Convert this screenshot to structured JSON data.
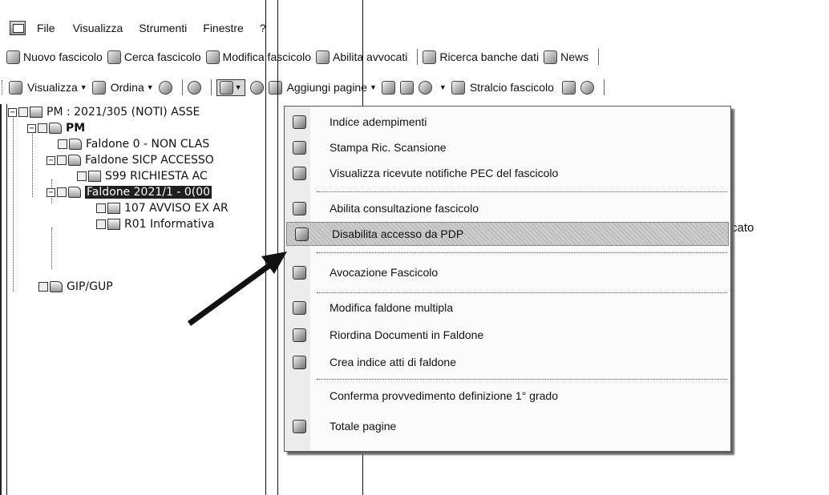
{
  "menubar": {
    "items": [
      "File",
      "Visualizza",
      "Strumenti",
      "Finestre",
      "?"
    ]
  },
  "toolbar1": {
    "buttons": [
      "Nuovo fascicolo",
      "Cerca fascicolo",
      "Modifica fascicolo",
      "Abilita avvocati",
      "Ricerca banche dati",
      "News"
    ]
  },
  "toolbar2": {
    "visualizza": "Visualizza",
    "ordina": "Ordina",
    "aggiungi_pagine": "Aggiungi pagine",
    "stralcio": "Stralcio fascicolo"
  },
  "tree": {
    "nodes": [
      "PM : 2021/305 (NOTI) ASSE",
      "PM",
      "Faldone 0 - NON CLAS",
      "Faldone SICP ACCESSO",
      "S99 RICHIESTA AC",
      "Faldone 2021/1 - 0(00",
      "107 AVVISO EX AR",
      "R01 Informativa",
      "GIP/GUP"
    ]
  },
  "right_panel": {
    "partial_text": "cato"
  },
  "context_menu": {
    "items": [
      {
        "label": "Indice adempimenti",
        "icon": "checklist-icon"
      },
      {
        "label": "Stampa Ric. Scansione",
        "icon": "barcode-icon"
      },
      {
        "label": "Visualizza ricevute notifiche PEC del fascicolo",
        "icon": "mail-receipt-icon"
      },
      {
        "label": "Abilita consultazione fascicolo",
        "icon": "key-icon"
      },
      {
        "label": "Disabilita accesso da PDP",
        "icon": "key-disable-icon"
      },
      {
        "label": "Avocazione Fascicolo",
        "icon": "avocation-icon"
      },
      {
        "label": "Modifica faldone multipla",
        "icon": "edit-icon"
      },
      {
        "label": "Riordina Documenti in Faldone",
        "icon": "reorder-icon"
      },
      {
        "label": "Crea indice atti di faldone",
        "icon": "index-icon"
      },
      {
        "label": "Conferma provvedimento definizione 1° grado",
        "icon": ""
      },
      {
        "label": "Totale pagine",
        "icon": "pages-icon"
      }
    ]
  }
}
